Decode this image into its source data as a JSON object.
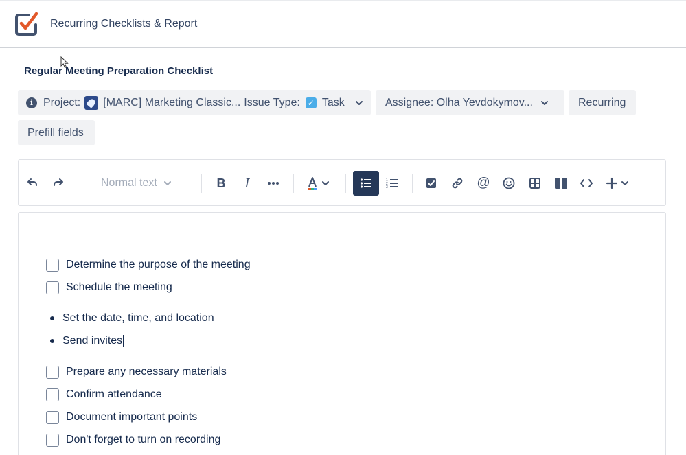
{
  "app": {
    "title": "Recurring Checklists & Report",
    "logo_icon": "checklist-logo-icon",
    "accent": "#e2582a"
  },
  "document": {
    "title": "Regular Meeting Preparation Checklist"
  },
  "fields": {
    "project_label": "Project:",
    "project_value": "[MARC] Marketing Classic...",
    "issue_type_label": "Issue Type:",
    "issue_type_value": "Task",
    "assignee": "Assignee: Olha Yevdokymov...",
    "recurring": "Recurring",
    "prefill": "Prefill fields"
  },
  "toolbar": {
    "text_style": "Normal text",
    "active_color": "#253858",
    "icons": [
      "undo-icon",
      "redo-icon",
      "bold-icon",
      "italic-icon",
      "more-icon",
      "text-color-icon",
      "bullet-list-icon",
      "numbered-list-icon",
      "action-item-icon",
      "link-icon",
      "mention-icon",
      "emoji-icon",
      "table-icon",
      "layout-icon",
      "code-icon",
      "insert-icon"
    ]
  },
  "content": {
    "items": [
      {
        "type": "check",
        "text": "Determine the purpose of the meeting"
      },
      {
        "type": "check",
        "text": "Schedule the meeting"
      },
      {
        "type": "bullet",
        "text": "Set the date, time, and location"
      },
      {
        "type": "bullet",
        "text": "Send invites"
      },
      {
        "type": "check",
        "text": "Prepare any necessary materials"
      },
      {
        "type": "check",
        "text": "Confirm attendance"
      },
      {
        "type": "check",
        "text": "Document important points"
      },
      {
        "type": "check",
        "text": "Don't forget to turn on recording"
      }
    ]
  }
}
